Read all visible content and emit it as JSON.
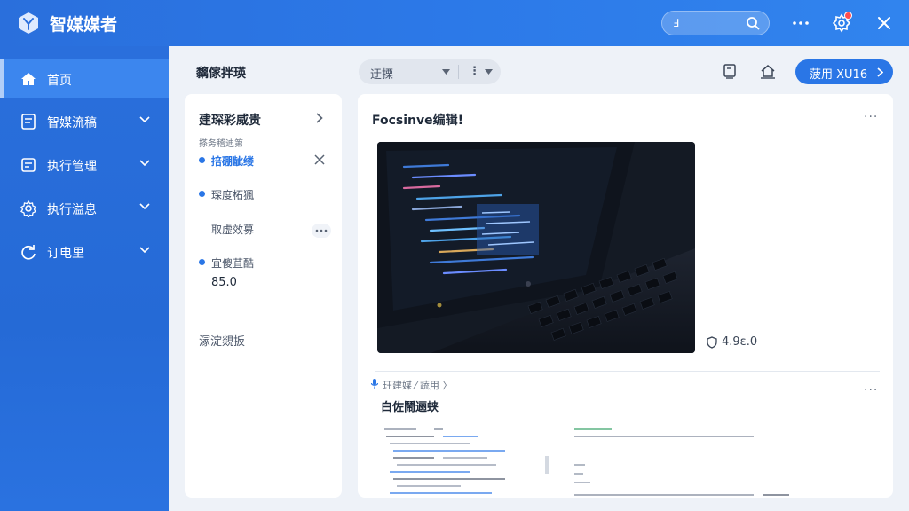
{
  "app": {
    "title": "智媒媒者"
  },
  "header": {
    "search_value": "Ⅎ",
    "search_placeholder": "",
    "icons": [
      "search-icon",
      "more-icon",
      "settings-icon",
      "close-icon"
    ],
    "notification_dot_color": "#ff4d4f"
  },
  "sidebar": {
    "items": [
      {
        "label": "首页",
        "icon": "home-icon",
        "active": true
      },
      {
        "label": "智媒流稿",
        "icon": "document-icon",
        "expandable": true
      },
      {
        "label": "执行管理",
        "icon": "list-icon",
        "expandable": true
      },
      {
        "label": "执行溢息",
        "icon": "gear-icon",
        "expandable": true
      },
      {
        "label": "订电里",
        "icon": "refresh-icon",
        "expandable": true
      }
    ]
  },
  "toolbar": {
    "page_title": "黐傢拌瑛",
    "filter_label": "迂搮",
    "more_glyph": "⋮",
    "primary_button_label": "菠用 XU16"
  },
  "left_card": {
    "title": "建琛彩威贵",
    "subtitle": "搽务稽迪第",
    "timeline": [
      {
        "label": "掊硼龇缕",
        "active": true
      },
      {
        "label": "琛度柘猦",
        "active": false
      },
      {
        "label": "取虚效募",
        "active": false
      },
      {
        "label": "宜傻苴酷",
        "active": false
      }
    ],
    "value": "85.0",
    "footer": "溕淀覢扳"
  },
  "right_card": {
    "title": "Focsinve编辑!",
    "rating": "4.9ε.0",
    "breadcrumb": "玨建媒 ⁄   蔬用 〉",
    "section_title": "白佐鬧逦蛱"
  },
  "colors": {
    "accent": "#2a76e6",
    "sidebar": "#2a6fdc",
    "sidebar_active": "#3c86ee"
  }
}
